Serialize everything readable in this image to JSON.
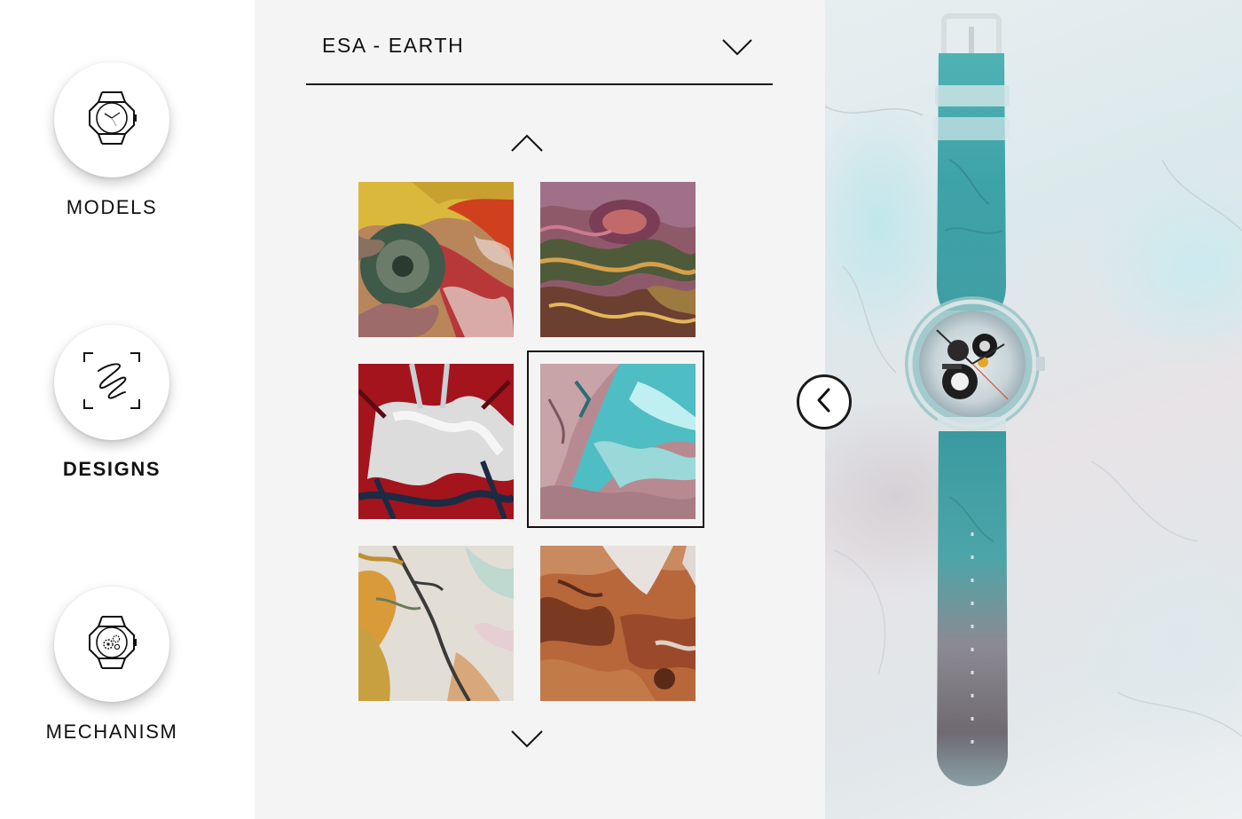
{
  "nav": {
    "items": [
      {
        "label": "MODELS",
        "icon": "watch-icon",
        "active": false
      },
      {
        "label": "DESIGNS",
        "icon": "design-sketch-icon",
        "active": true
      },
      {
        "label": "MECHANISM",
        "icon": "watch-mechanism-icon",
        "active": false
      }
    ]
  },
  "designs": {
    "collection_selected": "ESA - EARTH",
    "selected_index": 3,
    "tiles": [
      {
        "icon": "design-tile-volcano"
      },
      {
        "icon": "design-tile-swirls"
      },
      {
        "icon": "design-tile-glacier-red"
      },
      {
        "icon": "design-tile-turquoise-ice"
      },
      {
        "icon": "design-tile-river-delta"
      },
      {
        "icon": "design-tile-desert"
      }
    ]
  },
  "colors": {
    "panel_bg": "#f4f4f4",
    "preview_strap": "#3fa6a8",
    "border": "#111111"
  }
}
